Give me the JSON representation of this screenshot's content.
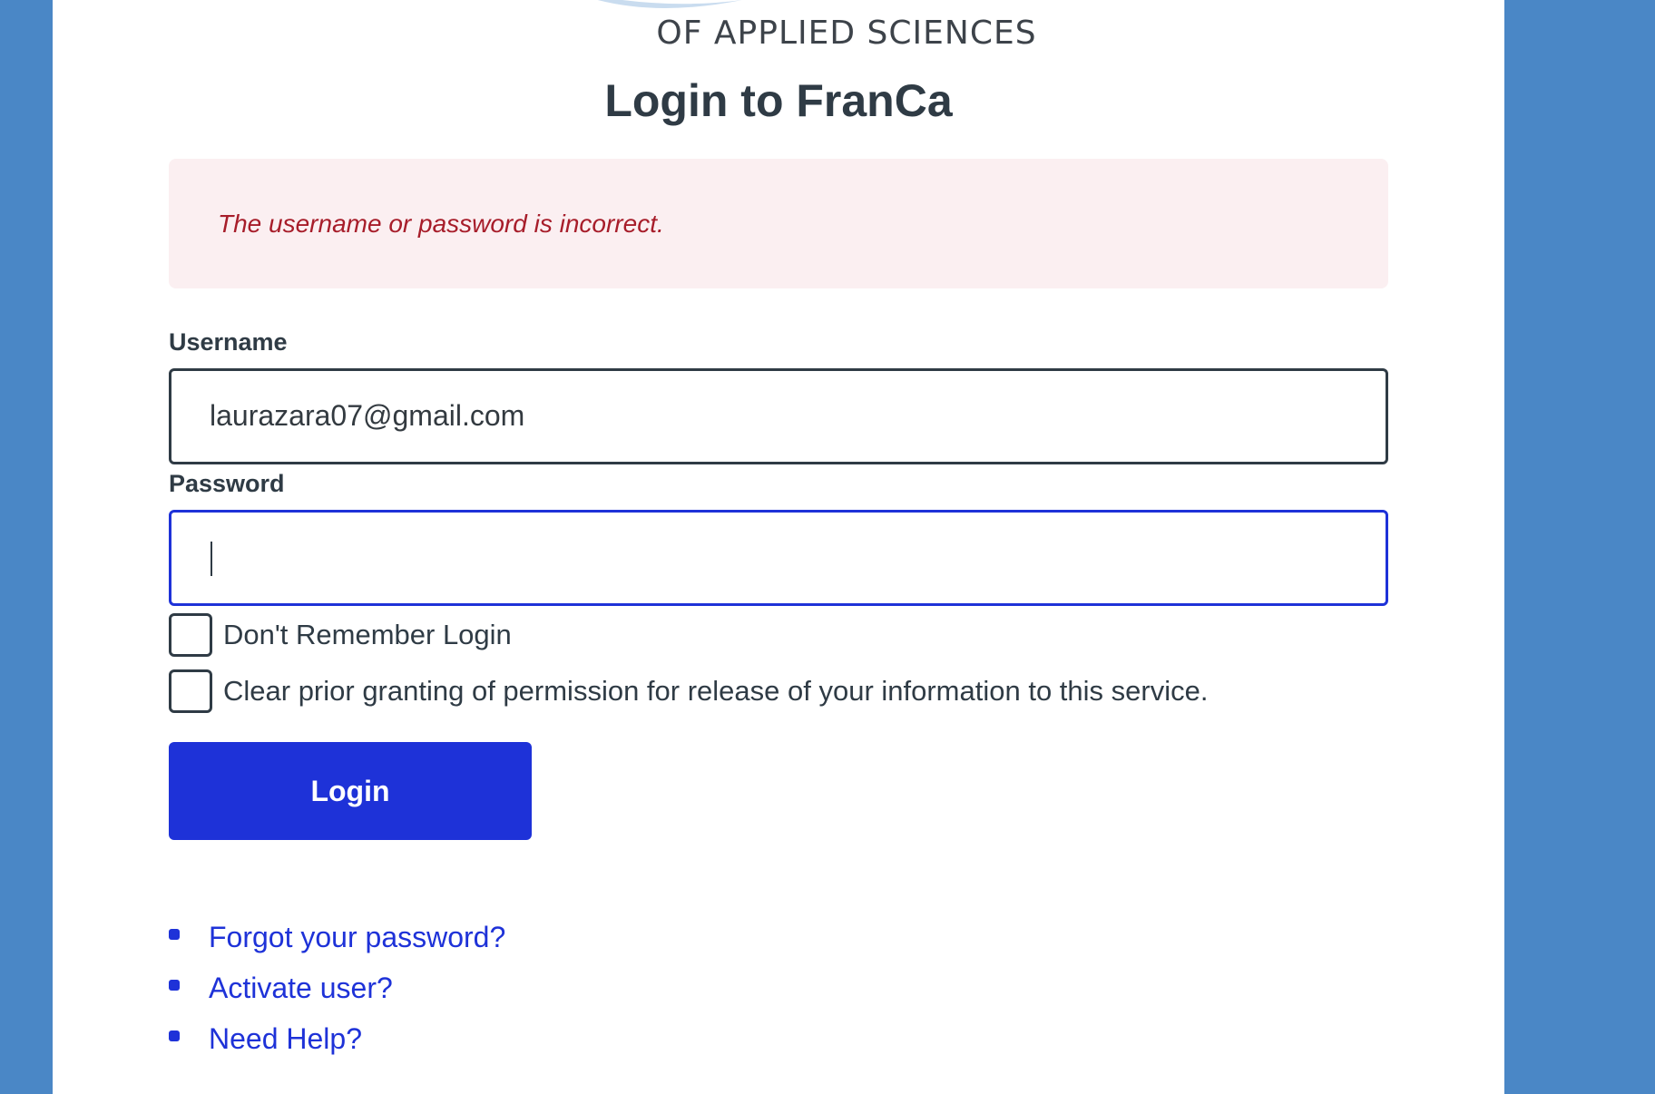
{
  "logo": {
    "text": "OF APPLIED SCIENCES"
  },
  "page": {
    "title": "Login to FranCa"
  },
  "error": {
    "message": "The username or password is incorrect."
  },
  "form": {
    "username_label": "Username",
    "username_value": "laurazara07@gmail.com",
    "password_label": "Password",
    "password_value": "",
    "dont_remember_label": "Don't Remember Login",
    "dont_remember_checked": false,
    "clear_consent_label": "Clear prior granting of permission for release of your information to this service.",
    "clear_consent_checked": false,
    "login_button": "Login"
  },
  "links": [
    {
      "label": "Forgot your password?"
    },
    {
      "label": "Activate user?"
    },
    {
      "label": "Need Help?"
    }
  ],
  "colors": {
    "background": "#4a87c6",
    "accent": "#1e32d8",
    "error_bg": "#fbeff1",
    "error_text": "#a71d2a",
    "text": "#2f3b45"
  }
}
